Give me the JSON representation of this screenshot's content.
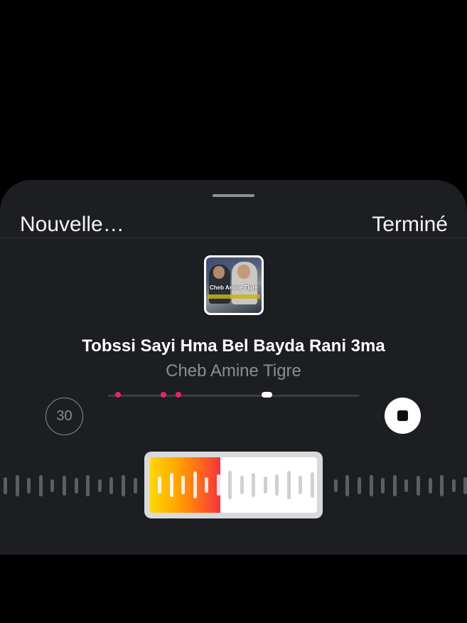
{
  "header": {
    "left_label": "Nouvelle…",
    "right_label": "Terminé"
  },
  "cover": {
    "caption": "Cheb Amine Tigre"
  },
  "song": {
    "title": "Tobssi Sayi Hma Bel Bayda Rani 3ma",
    "artist": "Cheb Amine Tigre"
  },
  "controls": {
    "timer_value": "30",
    "stop_icon": "stop-icon"
  },
  "timeline": {
    "markers": [
      0.04,
      0.22,
      0.28
    ],
    "playhead": 0.63
  },
  "selection": {
    "fill_progress": 0.42
  },
  "colors": {
    "accent_marker": "#e8265e",
    "gradient_start": "#ffd60a",
    "gradient_end": "#f5333f"
  }
}
